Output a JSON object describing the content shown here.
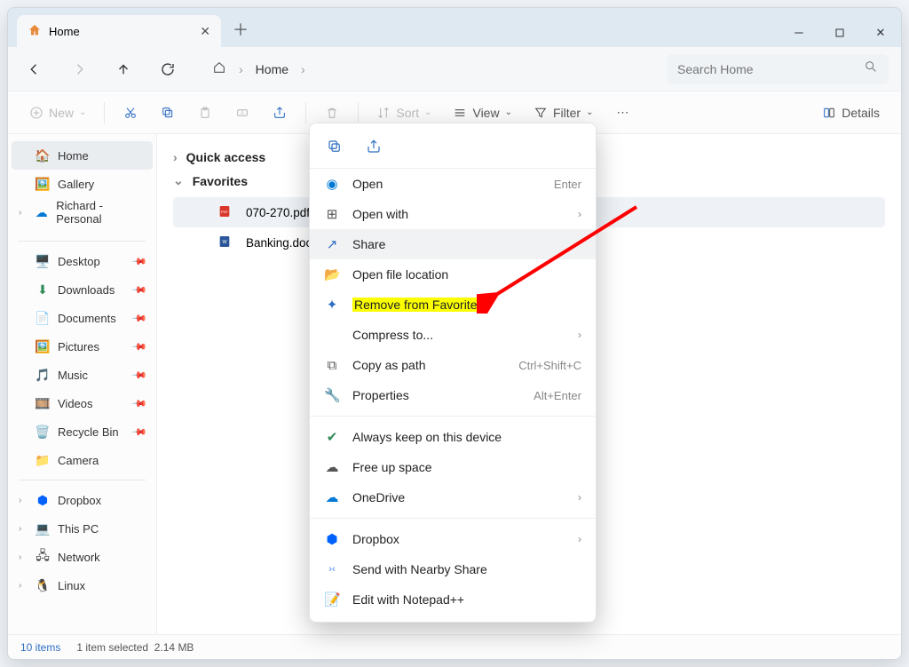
{
  "tab": {
    "title": "Home"
  },
  "breadcrumb": {
    "home": "Home"
  },
  "search": {
    "placeholder": "Search Home"
  },
  "toolbar": {
    "new": "New",
    "sort": "Sort",
    "view": "View",
    "filter": "Filter",
    "details": "Details"
  },
  "sidebar": {
    "home": "Home",
    "gallery": "Gallery",
    "personal": "Richard - Personal",
    "desktop": "Desktop",
    "downloads": "Downloads",
    "documents": "Documents",
    "pictures": "Pictures",
    "music": "Music",
    "videos": "Videos",
    "recycle": "Recycle Bin",
    "camera": "Camera",
    "dropbox": "Dropbox",
    "thispc": "This PC",
    "network": "Network",
    "linux": "Linux"
  },
  "groups": {
    "quick": "Quick access",
    "favorites": "Favorites"
  },
  "files": {
    "f1": "070-270.pdf",
    "f2": "Banking.docx"
  },
  "ctx": {
    "open": "Open",
    "open_sc": "Enter",
    "openwith": "Open with",
    "share": "Share",
    "openloc": "Open file location",
    "remove": "Remove from Favorites",
    "compress": "Compress to...",
    "copypath": "Copy as path",
    "copypath_sc": "Ctrl+Shift+C",
    "properties": "Properties",
    "properties_sc": "Alt+Enter",
    "keep": "Always keep on this device",
    "freeup": "Free up space",
    "onedrive": "OneDrive",
    "dropbox": "Dropbox",
    "nearby": "Send with Nearby Share",
    "editnpp": "Edit with Notepad++"
  },
  "status": {
    "count": "10 items",
    "sel": "1 item selected",
    "size": "2.14 MB"
  }
}
